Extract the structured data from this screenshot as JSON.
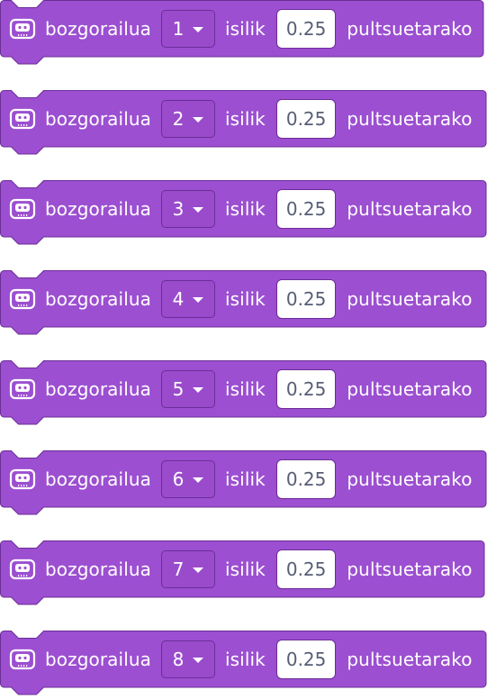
{
  "block_color": "#9c4fd1",
  "block_border": "#6b2d96",
  "block_icon": "microbit-icon",
  "blocks": [
    {
      "prefix": "bozgorailua",
      "pin": "1",
      "middle": "isilik",
      "duration": "0.25",
      "suffix": "pultsuetarako"
    },
    {
      "prefix": "bozgorailua",
      "pin": "2",
      "middle": "isilik",
      "duration": "0.25",
      "suffix": "pultsuetarako"
    },
    {
      "prefix": "bozgorailua",
      "pin": "3",
      "middle": "isilik",
      "duration": "0.25",
      "suffix": "pultsuetarako"
    },
    {
      "prefix": "bozgorailua",
      "pin": "4",
      "middle": "isilik",
      "duration": "0.25",
      "suffix": "pultsuetarako"
    },
    {
      "prefix": "bozgorailua",
      "pin": "5",
      "middle": "isilik",
      "duration": "0.25",
      "suffix": "pultsuetarako"
    },
    {
      "prefix": "bozgorailua",
      "pin": "6",
      "middle": "isilik",
      "duration": "0.25",
      "suffix": "pultsuetarako"
    },
    {
      "prefix": "bozgorailua",
      "pin": "7",
      "middle": "isilik",
      "duration": "0.25",
      "suffix": "pultsuetarako"
    },
    {
      "prefix": "bozgorailua",
      "pin": "8",
      "middle": "isilik",
      "duration": "0.25",
      "suffix": "pultsuetarako"
    }
  ]
}
